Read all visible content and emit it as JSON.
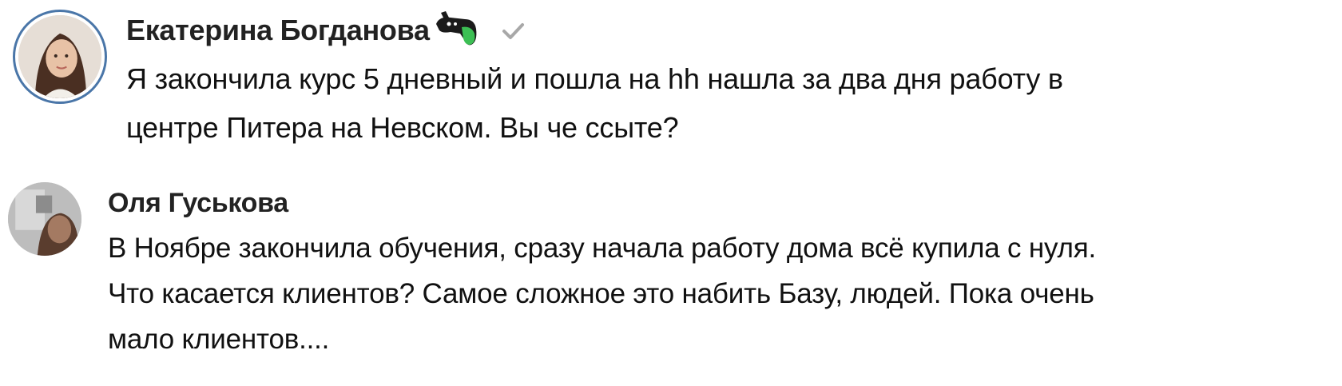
{
  "comments": [
    {
      "author": "Екатерина Богданова",
      "text_lines": [
        "Я закончила курс 5 дневный и пошла на hh нашла за два дня работу в",
        "центре Питера на Невском. Вы че ссыте?"
      ],
      "badges": [
        "gamepad-icon",
        "verified-icon"
      ]
    },
    {
      "author": "Оля Гуськова",
      "text_lines": [
        "В Ноябре закончила обучения, сразу начала работу дома всё купила с нуля.",
        "Что касается клиентов? Самое сложное это набить Базу, людей. Пока очень",
        "мало клиентов...."
      ]
    }
  ],
  "colors": {
    "avatar_ring": "#4a76a8",
    "author": "#222222",
    "text": "#111111",
    "verified": "#a8a8a8",
    "gamepad_green": "#3cbf54"
  }
}
